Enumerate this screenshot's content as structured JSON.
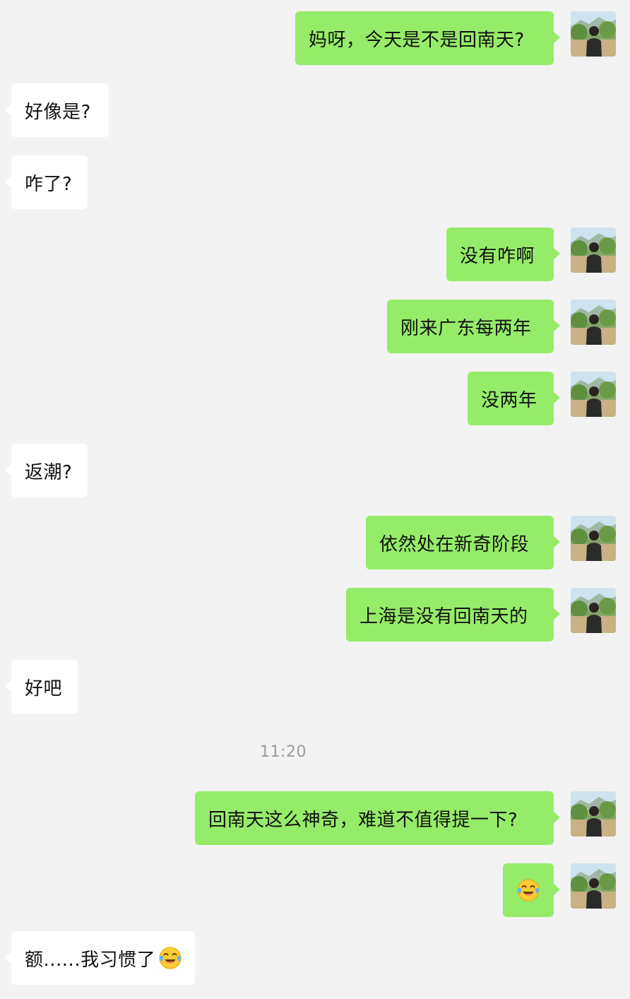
{
  "messages": [
    {
      "side": "me",
      "text": "妈呀，今天是不是回南天?"
    },
    {
      "side": "other",
      "text": "好像是?"
    },
    {
      "side": "other",
      "text": "咋了?"
    },
    {
      "side": "me",
      "text": "没有咋啊"
    },
    {
      "side": "me",
      "text": "刚来广东每两年"
    },
    {
      "side": "me",
      "text": "没两年"
    },
    {
      "side": "other",
      "text": "返潮?"
    },
    {
      "side": "me",
      "text": "依然处在新奇阶段"
    },
    {
      "side": "me",
      "text": "上海是没有回南天的"
    },
    {
      "side": "other",
      "text": "好吧"
    },
    {
      "side": "me",
      "text": "回南天这么神奇，难道不值得提一下?"
    },
    {
      "side": "me",
      "text": "",
      "emoji": "crying-laughing-emoji"
    },
    {
      "side": "other",
      "text": "额......我习惯了",
      "emoji": "crying-laughing-emoji"
    }
  ],
  "timestamp": "11:20",
  "colors": {
    "background": "#f3f3f3",
    "my_bubble": "#95ec69",
    "other_bubble": "#ffffff",
    "timestamp_text": "#9b9b9b"
  }
}
